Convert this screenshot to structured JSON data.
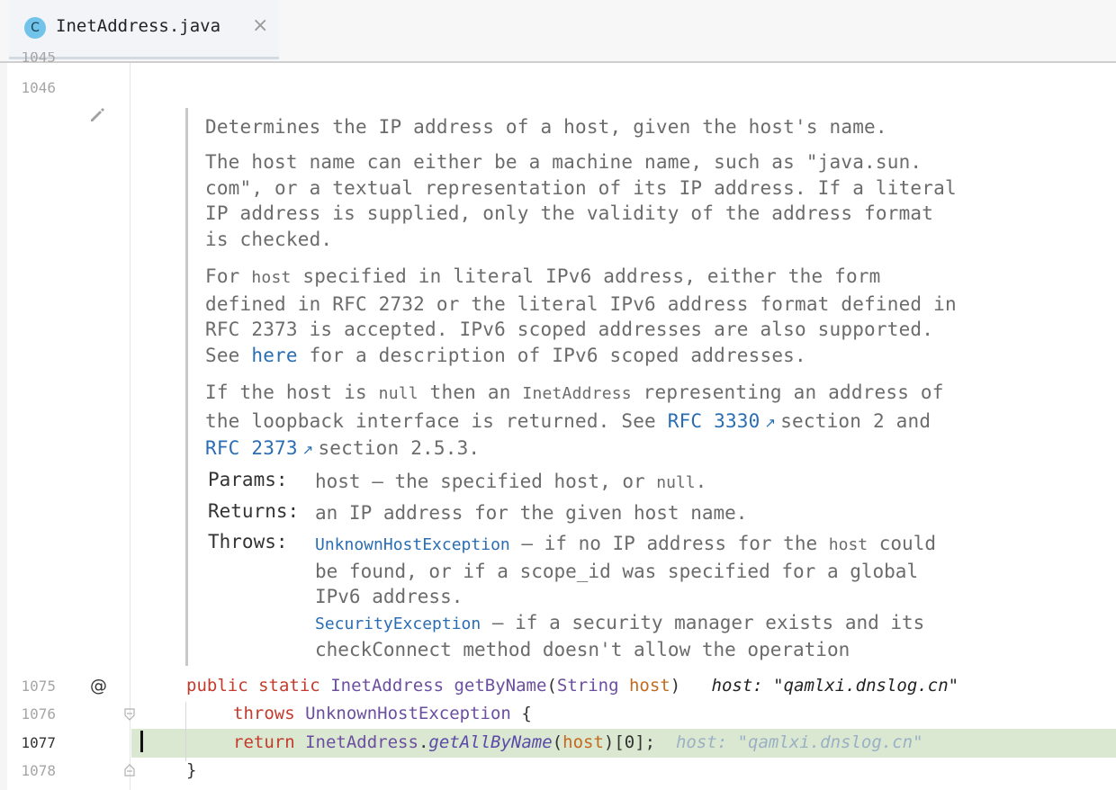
{
  "tab": {
    "badge": "C",
    "title": "InetAddress.java",
    "close": "×"
  },
  "gutter": {
    "line_numbers": [
      "1045",
      "1046",
      "1075",
      "1076",
      "1077",
      "1078"
    ],
    "current_line": "1077",
    "edit_icon": "pencil-icon",
    "override_marker": "@"
  },
  "doc": {
    "p1": "Determines the IP address of a host, given the host's name.",
    "p2": [
      "The host name can either be a machine name, such as \"java.sun.",
      "com\", or a textual representation of its IP address. If a literal",
      "IP address is supplied, only the validity of the address format",
      "is checked."
    ],
    "p3": {
      "l1_pre": "For ",
      "l1_code": "host",
      "l1_post": " specified in literal IPv6 address, either the form",
      "l2": "defined in RFC 2732 or the literal IPv6 address format defined in",
      "l3": "RFC 2373 is accepted. IPv6 scoped addresses are also supported.",
      "l4_pre": "See ",
      "l4_link": "here",
      "l4_post": " for a description of IPv6 scoped addresses."
    },
    "p4": {
      "l1_a": "If the host is ",
      "l1_code1": "null",
      "l1_b": " then an ",
      "l1_code2": "InetAddress",
      "l1_c": " representing an address of",
      "l2_a": "the loopback interface is returned. See ",
      "l2_link": "RFC 3330",
      "l2_b": " section 2 and",
      "l3_link": "RFC 2373",
      "l3_b": " section 2.5.3."
    },
    "params_label": "Params:",
    "params_pre": "host – the specified host, or ",
    "params_code": "null",
    "params_post": ".",
    "returns_label": "Returns:",
    "returns": "an IP address for the given host name.",
    "throws_label": "Throws:",
    "throws1_link": "UnknownHostException",
    "throws1_a": " – if no IP address for the ",
    "throws1_code": "host",
    "throws1_b": " could",
    "throws1_l2": "be found, or if a scope_id was specified for a global",
    "throws1_l3": "IPv6 address.",
    "throws2_link": "SecurityException",
    "throws2_a": " – if a security manager exists and its",
    "throws2_l2": "checkConnect method doesn't allow the operation"
  },
  "code": {
    "l1075": {
      "kw1": "public",
      "kw2": "static",
      "type": "InetAddress",
      "fn": "getByName",
      "open": "(",
      "ptype": "String",
      "pname": "host",
      "close": ")",
      "hint": "host: \"qamlxi.dnslog.cn\""
    },
    "l1076": {
      "kw": "throws",
      "type": "UnknownHostException",
      "brace": "{"
    },
    "l1077": {
      "kw": "return",
      "type": "InetAddress",
      "dot": ".",
      "fn": "getAllByName",
      "open": "(",
      "arg": "host",
      "rest": ")[0];",
      "hint": "host: \"qamlxi.dnslog.cn\""
    },
    "l1078": {
      "brace": "}"
    }
  }
}
